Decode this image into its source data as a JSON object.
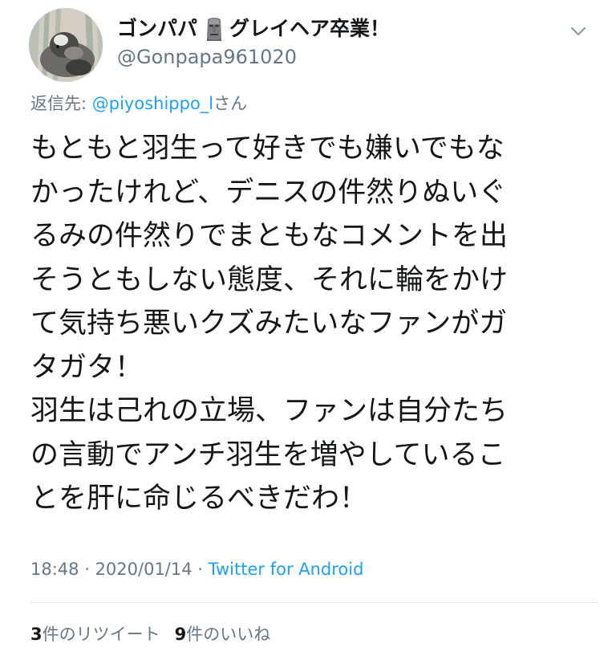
{
  "user": {
    "display_name_prefix": "ゴンパパ",
    "display_name_suffix": "グレイヘア卒業！",
    "name_emoji": "moai-emoji-icon",
    "handle": "@Gonpapa961020",
    "menu_icon": "chevron-down-icon"
  },
  "reply": {
    "prefix": "返信先: ",
    "mention": "@piyoshippo_l",
    "suffix": "さん"
  },
  "tweet": {
    "lines": [
      "もともと羽生って好きでも嫌いでもな",
      "かったけれど、デニスの件然りぬいぐ",
      "るみの件然りでまともなコメントを出",
      "そうともしない態度、それに輪をかけ",
      "て気持ち悪いクズみたいなファンがガ",
      "タガタ！",
      "羽生は己れの立場、ファンは自分たち",
      "の言動でアンチ羽生を増やしているこ",
      "とを肝に命じるべきだわ！"
    ]
  },
  "meta": {
    "time": "18:48",
    "separator": " · ",
    "date": "2020/01/14",
    "source": "Twitter for Android"
  },
  "stats": {
    "retweet_count": "3",
    "retweet_label": "件のリツイート",
    "like_count": "9",
    "like_label": "件のいいね"
  },
  "colors": {
    "text": "#14171a",
    "secondary": "#657786",
    "link": "#1da1f2",
    "divider": "#e1e8ed"
  }
}
